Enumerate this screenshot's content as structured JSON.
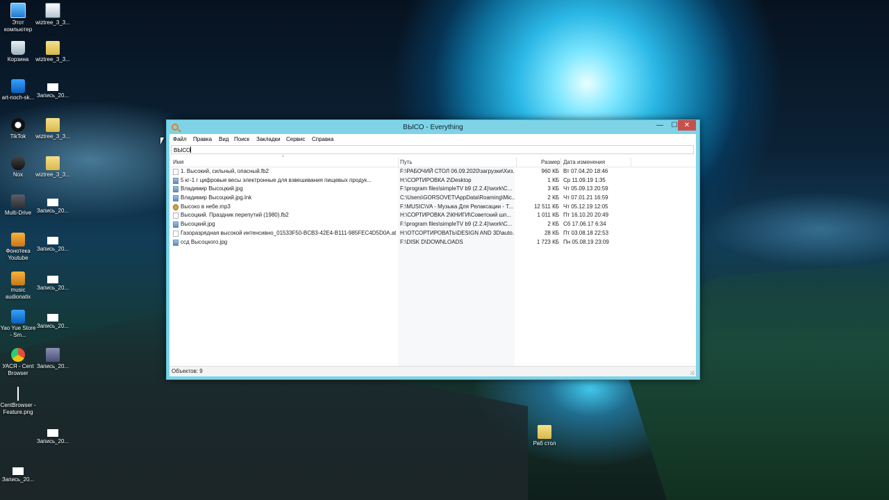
{
  "desktop": {
    "icons": [
      {
        "label": "Этот компьютер",
        "icon": "computer-icon",
        "cls": "g-pc"
      },
      {
        "label": "wiztree_3_3...",
        "icon": "installer-icon",
        "cls": "g-app"
      },
      {
        "label": "Корзина",
        "icon": "recycle-bin-icon",
        "cls": "g-bin"
      },
      {
        "label": "wiztree_3_3...",
        "icon": "archive-icon",
        "cls": "g-folder"
      },
      {
        "label": "art-noch-sk...",
        "icon": "image-icon",
        "cls": "g-blue"
      },
      {
        "label": "Запись_20...",
        "icon": "video-file-icon",
        "cls": "g-file"
      },
      {
        "label": "TikTok",
        "icon": "tiktok-icon",
        "cls": "g-tiktok"
      },
      {
        "label": "wiztree_3_3...",
        "icon": "archive-icon",
        "cls": "g-folder"
      },
      {
        "label": "Nox",
        "icon": "nox-icon",
        "cls": "g-nox"
      },
      {
        "label": "wiztree_3_3...",
        "icon": "archive-icon",
        "cls": "g-folder"
      },
      {
        "label": "Multi-Drive",
        "icon": "drive-icon",
        "cls": "g-drive"
      },
      {
        "label": "Запись_20...",
        "icon": "video-file-icon",
        "cls": "g-file"
      },
      {
        "label": "Фонотека Youtube",
        "icon": "music-folder-icon",
        "cls": "g-orange"
      },
      {
        "label": "Запись_20...",
        "icon": "video-file-icon",
        "cls": "g-file"
      },
      {
        "label": "music audionatix",
        "icon": "music-folder-icon",
        "cls": "g-orange"
      },
      {
        "label": "Запись_20...",
        "icon": "video-file-icon",
        "cls": "g-file"
      },
      {
        "label": "Yao Yue Store - Sm...",
        "icon": "store-icon",
        "cls": "g-blue"
      },
      {
        "label": "Запись_20...",
        "icon": "video-file-icon",
        "cls": "g-file"
      },
      {
        "label": "УАСЯ - Cent Browser",
        "icon": "browser-icon",
        "cls": "g-browser"
      },
      {
        "label": "Запись_20...",
        "icon": "mpc-file-icon",
        "cls": "g-mph"
      },
      {
        "label": "CentBrowser - Feature.png",
        "icon": "png-file-icon",
        "cls": "g-line"
      },
      {
        "label": "Запись_20...",
        "icon": "video-file-icon",
        "cls": "g-file"
      },
      {
        "label": "Запись_20...",
        "icon": "video-file-icon",
        "cls": "g-file"
      },
      {
        "label": "Раб стол",
        "icon": "archive-icon",
        "cls": "g-folder"
      }
    ]
  },
  "window": {
    "title": "ВЫСО - Everything",
    "controls": {
      "minimize": "—",
      "maximize": "☐",
      "close": "✕"
    },
    "menu": [
      "Файл",
      "Правка",
      "Вид",
      "Поиск",
      "Закладки",
      "Сервис",
      "Справка"
    ],
    "search_value": "ВЫСО",
    "columns": {
      "name": "Имя",
      "path": "Путь",
      "size": "Размер",
      "date": "Дата изменения"
    },
    "files": [
      {
        "icon": "fi-doc",
        "name": "1. Высокий, сильный, опасный.fb2",
        "path": "F:\\РАБОЧИЙ СТОЛ 06.09.2020\\загрузки\\Хиз...",
        "size": "960 КБ",
        "date": "Вт 07.04.20 18:46"
      },
      {
        "icon": "fi-img",
        "name": "5 кг-1 г цифровые весы электронные для взвешивания пищевых продук...",
        "path": "H:\\СОРТИРОВКА 2\\Desktop",
        "size": "1 КБ",
        "date": "Ср 11.09.19 1:35"
      },
      {
        "icon": "fi-img",
        "name": "Владимир Высоцкий.jpg",
        "path": "F:\\program files\\simpleTV b9 (2.2.4)\\work\\C...",
        "size": "3 КБ",
        "date": "Чт 05.09.13 20:59"
      },
      {
        "icon": "fi-lnk",
        "name": "Владимир Высоцкий.jpg.lnk",
        "path": "C:\\Users\\GORSOVET\\AppData\\Roaming\\Mic...",
        "size": "2 КБ",
        "date": "Чт 07.01.21 16:59"
      },
      {
        "icon": "fi-mp3",
        "name": "Высоко в небе.mp3",
        "path": "F:\\MUSIC\\VA - Музыка Для Релаксации - Т...",
        "size": "12 511 КБ",
        "date": "Чт 05.12.19 12:05"
      },
      {
        "icon": "fi-doc",
        "name": "Высоцкий. Праздник перепутий (1980).fb2",
        "path": "H:\\СОРТИРОВКА 2\\КНИГИ\\Советский шп...",
        "size": "1 011 КБ",
        "date": "Пт 16.10.20 20:49"
      },
      {
        "icon": "fi-img",
        "name": "Высоцкий.jpg",
        "path": "F:\\program files\\simpleTV b9 (2.2.4)\\work\\C...",
        "size": "2 КБ",
        "date": "Сб 17.06.17 6:34"
      },
      {
        "icon": "fi-doc",
        "name": "Газоразрядная высокой интенсивно_01533F50-BCB3-42E4-B111-985FEC4D5D0A.atc",
        "path": "H:\\ОТСОРТИРОВАТЬ\\DESIGN AND 3D\\auto...",
        "size": "28 КБ",
        "date": "Пт 03.08.18 22:53"
      },
      {
        "icon": "fi-img",
        "name": "ссд Высоцкого.jpg",
        "path": "F:\\DISK D\\DOWNLOADS",
        "size": "1 723 КБ",
        "date": "Пн 05.08.19 23:09"
      }
    ],
    "status": "Объектов: 9"
  }
}
